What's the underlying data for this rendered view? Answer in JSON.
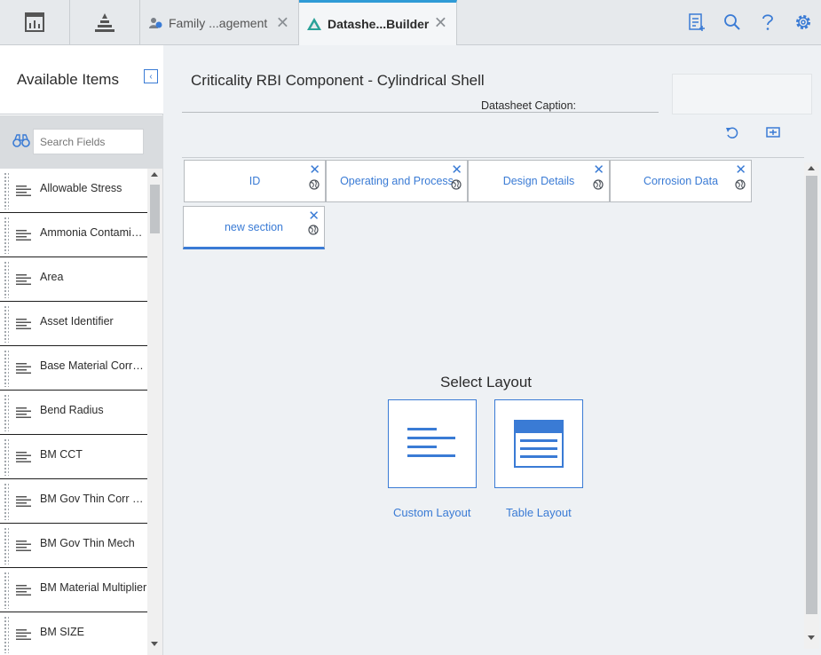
{
  "topbar": {
    "tabs": [
      {
        "label": "Family ...agement",
        "icon": "family-management-icon"
      },
      {
        "label": "Datashe...Builder",
        "icon": "datasheet-builder-icon",
        "active": true
      }
    ],
    "tools": [
      "new-query-icon",
      "search-icon",
      "help-icon",
      "settings-icon"
    ]
  },
  "sidebar": {
    "title": "Available Items",
    "search_placeholder": "Search Fields",
    "items": [
      {
        "label": "Allowable Stress"
      },
      {
        "label": "Ammonia Contaminant"
      },
      {
        "label": "Area"
      },
      {
        "label": "Asset Identifier"
      },
      {
        "label": "Base Material Corrosion"
      },
      {
        "label": "Bend Radius"
      },
      {
        "label": "BM CCT"
      },
      {
        "label": "BM Gov Thin Corr Rate"
      },
      {
        "label": "BM Gov Thin Mech"
      },
      {
        "label": "BM Material Multiplier"
      },
      {
        "label": "BM SIZE"
      }
    ]
  },
  "main": {
    "title": "Criticality RBI Component - Cylindrical Shell",
    "caption_label": "Datasheet Caption:",
    "sections": [
      {
        "label": "ID"
      },
      {
        "label": "Operating and Process"
      },
      {
        "label": "Design Details"
      },
      {
        "label": "Corrosion Data"
      },
      {
        "label": "new section",
        "active": true
      }
    ],
    "select_layout": "Select Layout",
    "layouts": [
      {
        "label": "Custom Layout"
      },
      {
        "label": "Table Layout"
      }
    ]
  },
  "colors": {
    "accent": "#3a7bd5",
    "active_tab_bar": "#2f9bd6"
  }
}
